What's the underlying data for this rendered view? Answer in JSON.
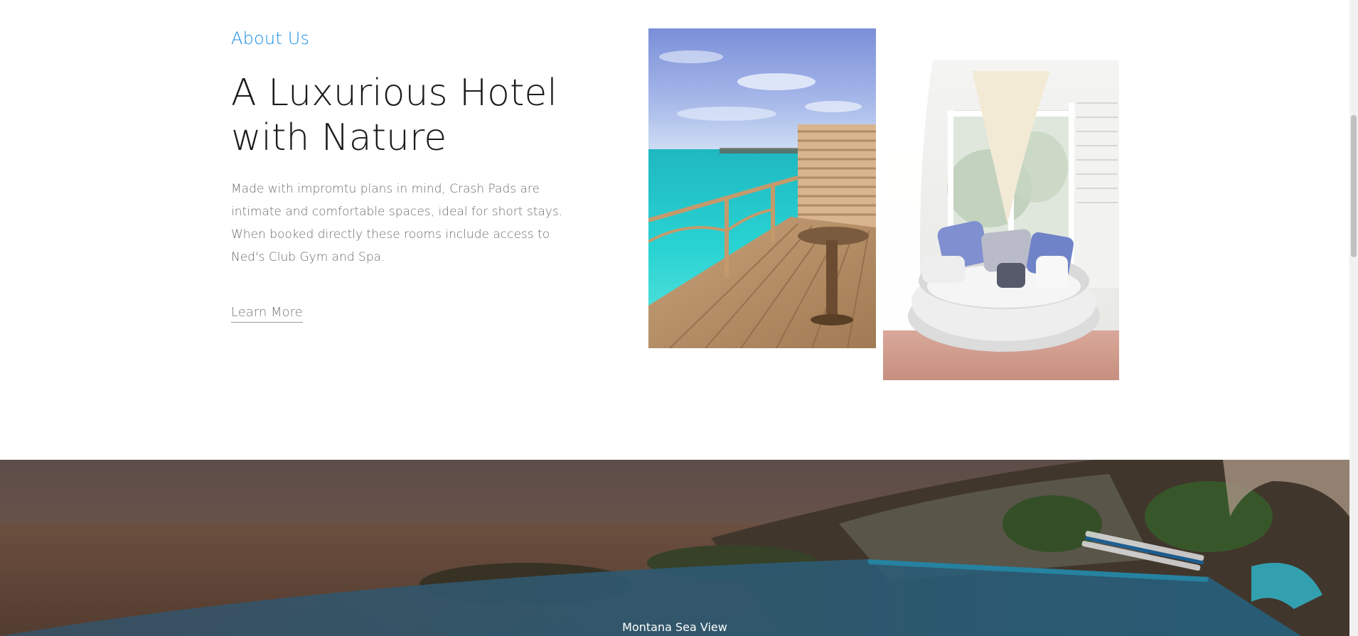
{
  "about": {
    "kicker": "About Us",
    "title": "A Luxurious Hotel with Nature",
    "description": "Made with impromtu plans in mind, Crash Pads are intimate and comfortable spaces, ideal for short stays. When booked directly these rooms include access to Ned's Club Gym and Spa.",
    "cta_label": "Learn More"
  },
  "gallery": {
    "images": [
      {
        "name": "overwater-deck-photo"
      },
      {
        "name": "lounge-chair-photo"
      }
    ]
  },
  "hero": {
    "caption": "Montana Sea View"
  },
  "colors": {
    "accent": "#1a8fe3",
    "heading": "#1b1b1b",
    "body_text": "#6d6d6d"
  }
}
